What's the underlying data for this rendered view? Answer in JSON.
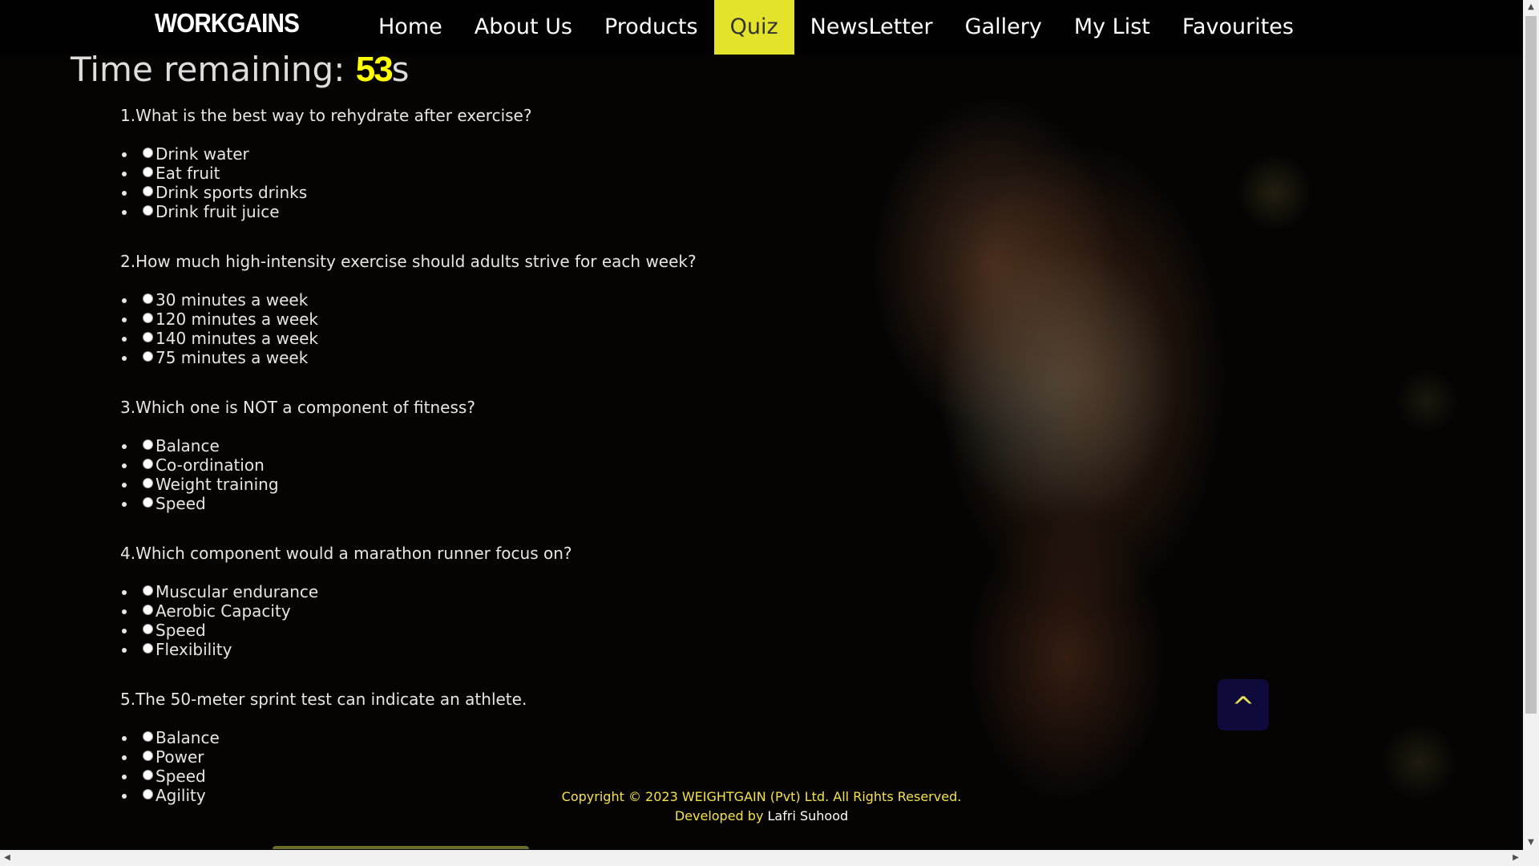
{
  "nav": {
    "logo": "WORKGAINS",
    "items": [
      {
        "label": "Home",
        "active": false
      },
      {
        "label": "About Us",
        "active": false
      },
      {
        "label": "Products",
        "active": false
      },
      {
        "label": "Quiz",
        "active": true
      },
      {
        "label": "NewsLetter",
        "active": false
      },
      {
        "label": "Gallery",
        "active": false
      },
      {
        "label": "My List",
        "active": false
      },
      {
        "label": "Favourites",
        "active": false
      }
    ],
    "active_color": "#e3e32b"
  },
  "timer": {
    "label": "Time remaining: ",
    "seconds": "53",
    "unit": "s",
    "seconds_color": "#ffff00"
  },
  "questions": [
    {
      "text": "1.What is the best way to rehydrate after exercise?",
      "options": [
        "Drink water",
        "Eat fruit",
        "Drink sports drinks",
        "Drink fruit juice"
      ]
    },
    {
      "text": "2.How much high-intensity exercise should adults strive for each week?",
      "options": [
        "30 minutes a week",
        "120 minutes a week",
        "140 minutes a week",
        "75 minutes a week"
      ]
    },
    {
      "text": "3.Which one is NOT a component of fitness?",
      "options": [
        "Balance",
        "Co-ordination",
        "Weight training",
        "Speed"
      ]
    },
    {
      "text": "4.Which component would a marathon runner focus on?",
      "options": [
        "Muscular endurance",
        "Aerobic Capacity",
        "Speed",
        "Flexibility"
      ]
    },
    {
      "text": "5.The 50-meter sprint test can indicate an athlete.",
      "options": [
        "Balance",
        "Power",
        "Speed",
        "Agility"
      ]
    }
  ],
  "footer": {
    "copyright": "Copyright © 2023 WEIGHTGAIN (Pvt) Ltd. All Rights Reserved.",
    "developed_by_label": "Developed by ",
    "developer": "Lafri Suhood"
  },
  "back_to_top": {
    "glyph": "^",
    "icon": "chevron-up-icon"
  }
}
